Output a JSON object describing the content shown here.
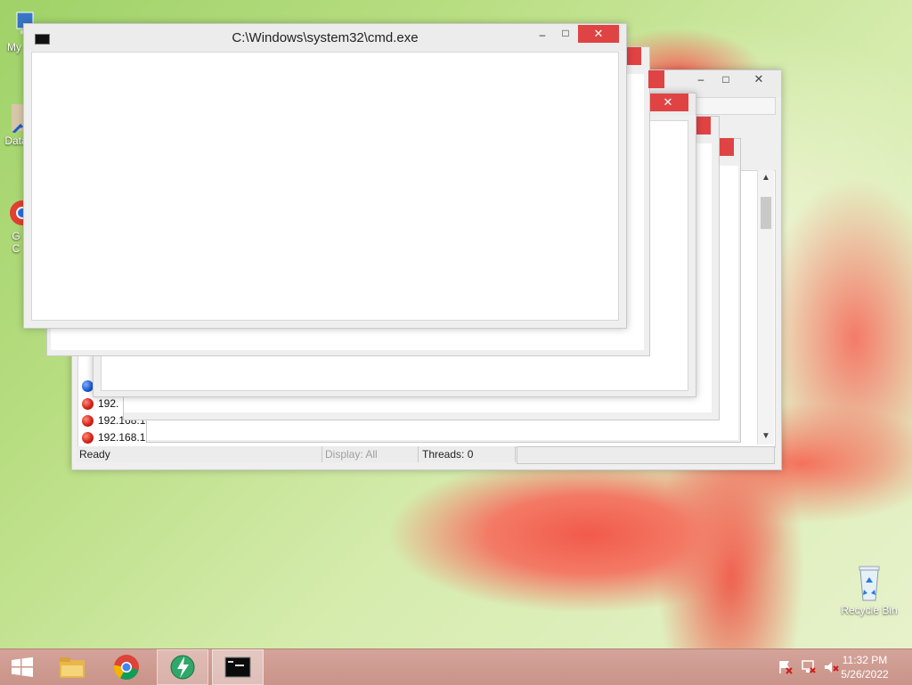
{
  "desktop": {
    "icons": [
      {
        "label": "My C"
      },
      {
        "label": "Data"
      },
      {
        "label": "G"
      },
      {
        "label": "C"
      },
      {
        "label": "Recycle Bin"
      }
    ]
  },
  "cmd_window": {
    "title": "C:\\Windows\\system32\\cmd.exe",
    "minimize": "–",
    "maximize": "□",
    "close": "✕"
  },
  "back_window": {
    "minimize": "–",
    "maximize": "□",
    "close": "✕"
  },
  "mid_window": {
    "maximize": "□",
    "close": "✕"
  },
  "list_rows": [
    {
      "text": "192."
    },
    {
      "text": "192.168.1"
    },
    {
      "text": "192.168.1"
    }
  ],
  "status": {
    "ready": "Ready",
    "display": "Display: All",
    "threads": "Threads: 0"
  },
  "clock": {
    "time": "11:32 PM",
    "date": "5/26/2022"
  }
}
